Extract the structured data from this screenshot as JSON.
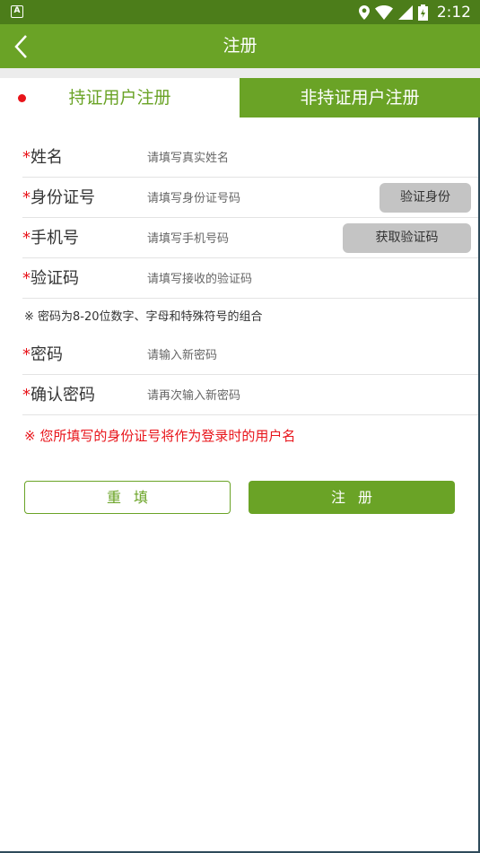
{
  "status_bar": {
    "time": "2:12",
    "notification_icon": "A",
    "icons": [
      "location-icon",
      "wifi-icon",
      "signal-icon",
      "battery-charging-icon"
    ]
  },
  "toolbar": {
    "back_icon": "chevron-left-icon",
    "title": "注册"
  },
  "tabs": [
    {
      "label": "持证用户注册",
      "selected": false
    },
    {
      "label": "非持证用户注册",
      "selected": true
    }
  ],
  "form": {
    "required_mark": "*",
    "name": {
      "label": "姓名",
      "placeholder": "请填写真实姓名",
      "value": ""
    },
    "id_number": {
      "label": "身份证号",
      "placeholder": "请填写身份证号码",
      "value": "",
      "button": "验证身份"
    },
    "phone": {
      "label": "手机号",
      "placeholder": "请填写手机号码",
      "value": "",
      "button": "获取验证码"
    },
    "code": {
      "label": "验证码",
      "placeholder": "请填写接收的验证码",
      "value": ""
    },
    "password_hint": "※ 密码为8-20位数字、字母和特殊符号的组合",
    "password": {
      "label": "密码",
      "placeholder": "请输入新密码",
      "value": ""
    },
    "confirm_password": {
      "label": "确认密码",
      "placeholder": "请再次输入新密码",
      "value": ""
    }
  },
  "warning": "※ 您所填写的身份证号将作为登录时的用户名",
  "actions": {
    "reset_label": "重填",
    "submit_label": "注册"
  },
  "colors": {
    "primary": "#6aa326",
    "status_bar": "#4c7d1a",
    "required": "#e8141a",
    "gray_button": "#c4c4c4"
  }
}
